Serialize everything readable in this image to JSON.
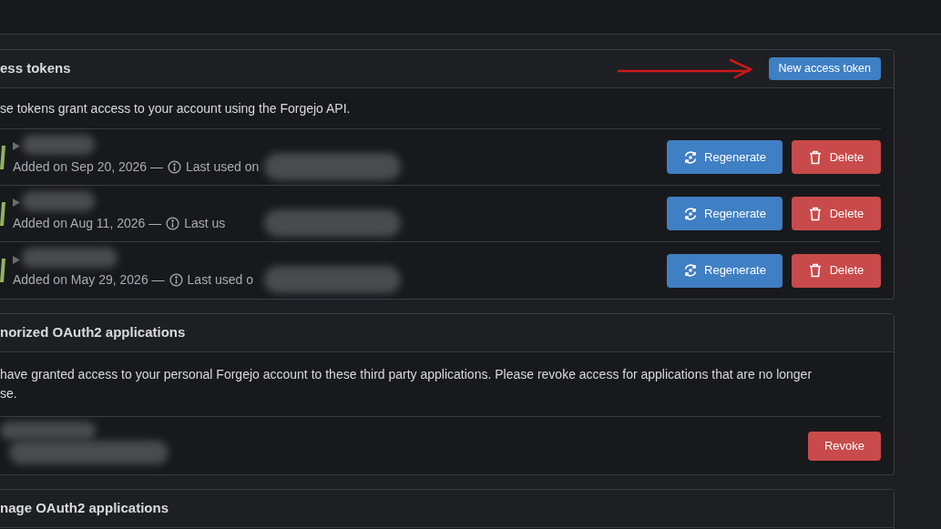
{
  "access_tokens": {
    "title": "ess tokens",
    "new_button": "New access token",
    "description": "se tokens grant access to your account using the Forgejo API.",
    "tokens": [
      {
        "added": "Added on Sep 20, 2026 —",
        "last_used": "Last used on",
        "regenerate": "Regenerate",
        "delete": "Delete"
      },
      {
        "added": "Added on Aug 11, 2026 —",
        "last_used": "Last us",
        "regenerate": "Regenerate",
        "delete": "Delete"
      },
      {
        "added": "Added on May 29, 2026 —",
        "last_used": "Last used o",
        "regenerate": "Regenerate",
        "delete": "Delete"
      }
    ]
  },
  "authorized_apps": {
    "title": "norized OAuth2 applications",
    "description": "have granted access to your personal Forgejo account to these third party applications. Please revoke access for applications that are no longer se.",
    "apps": [
      {
        "revoke": "Revoke"
      }
    ]
  },
  "manage_apps": {
    "title": "nage OAuth2 applications"
  }
}
